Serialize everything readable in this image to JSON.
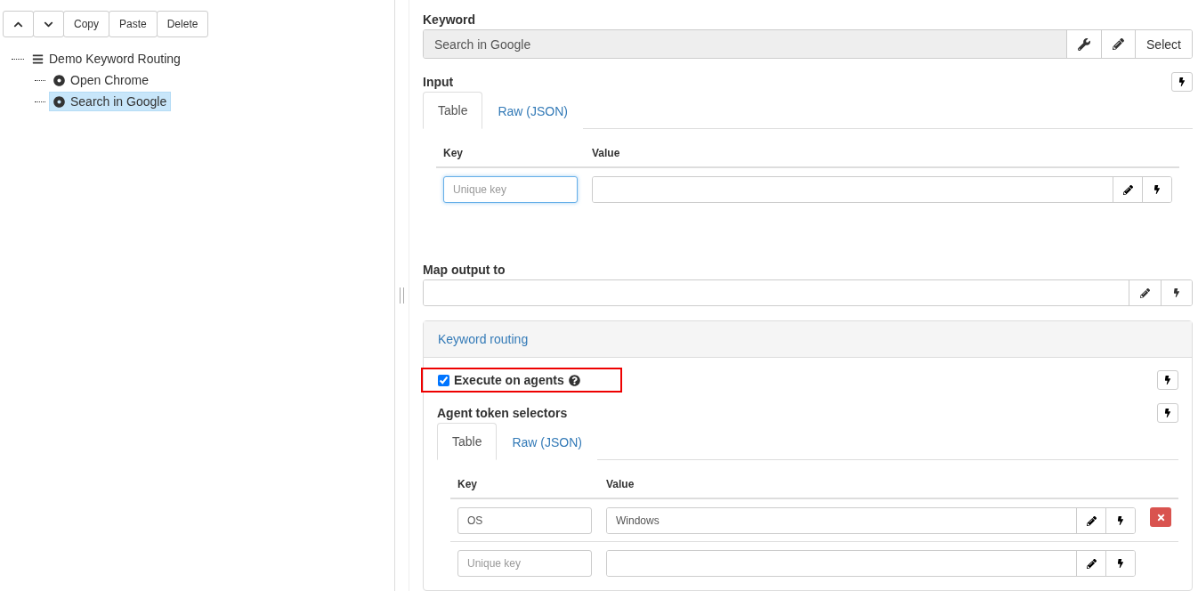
{
  "toolbar": [
    {
      "kind": "up"
    },
    {
      "kind": "down"
    },
    {
      "kind": "text",
      "label": "Copy"
    },
    {
      "kind": "text",
      "label": "Paste"
    },
    {
      "kind": "text",
      "label": "Delete"
    }
  ],
  "tree": {
    "label": "Demo Keyword Routing",
    "kind": "list",
    "selected": false,
    "children": [
      {
        "label": "Open Chrome",
        "kind": "step",
        "selected": false
      },
      {
        "label": "Search in Google",
        "kind": "step",
        "selected": true
      }
    ]
  },
  "keyword": {
    "label": "Keyword",
    "value": "Search in Google",
    "select": "Select"
  },
  "input": {
    "label": "Input",
    "tabs": [
      {
        "label": "Table",
        "selected": true
      },
      {
        "label": "Raw (JSON)",
        "selected": false
      }
    ],
    "columns": [
      "Key",
      "Value"
    ],
    "rows": [
      {
        "placeholder": "Unique key",
        "focused": true,
        "removable": false
      }
    ]
  },
  "map_output": {
    "label": "Map output to"
  },
  "routing": {
    "title": "Keyword routing",
    "execute": {
      "label": "Execute on agents",
      "checked": true,
      "highlighted": true
    },
    "selectors": {
      "label": "Agent token selectors",
      "tabs": [
        {
          "label": "Table",
          "selected": true
        },
        {
          "label": "Raw (JSON)",
          "selected": false
        }
      ],
      "columns": [
        "Key",
        "Value"
      ],
      "rows": [
        {
          "key": "OS",
          "value": "Windows",
          "focused": false,
          "removable": true
        },
        {
          "placeholder": "Unique key",
          "focused": false,
          "removable": false
        }
      ]
    }
  }
}
